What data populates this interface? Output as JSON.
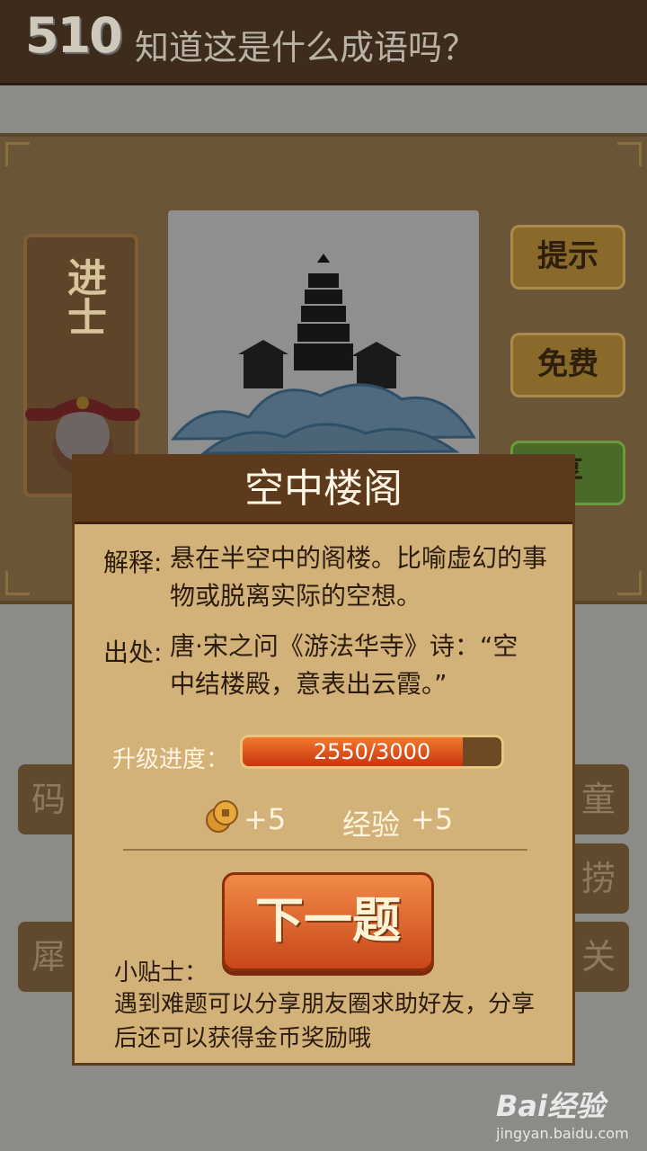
{
  "header": {
    "level": "510",
    "title": "知道这是什么成语吗？"
  },
  "rank": {
    "label": "进士"
  },
  "side_buttons": [
    {
      "label": "提示",
      "icon": "hint"
    },
    {
      "label": "免费",
      "icon": "free"
    },
    {
      "label": "享",
      "icon": "share"
    }
  ],
  "tiles": [
    "码",
    "犀",
    "童",
    "捞",
    "关"
  ],
  "dialog": {
    "idiom": "空中楼阁",
    "explain_label": "解释:",
    "explain_text": "悬在半空中的阁楼。比喻虚幻的事物或脱离实际的空想。",
    "source_label": "出处:",
    "source_text": "唐·宋之问《游法华寺》诗：“空中结楼殿，意表出云霞。”",
    "progress_label": "升级进度：",
    "progress_text": "2550/3000",
    "progress_value": 0.85,
    "coin_reward": "+5",
    "exp_label": "经验",
    "exp_reward": "+5",
    "next_button": "下一题",
    "tip_title": "小贴士：",
    "tip_text": "遇到难题可以分享朋友圈求助好友，分享后还可以获得金币奖励哦"
  },
  "watermark": {
    "logo": "Bai经验",
    "url": "jingyan.baidu.com"
  },
  "colors": {
    "accent": "#c9471a",
    "dialog_bg": "#d3b27a",
    "header_bg": "#3d2c1c"
  }
}
